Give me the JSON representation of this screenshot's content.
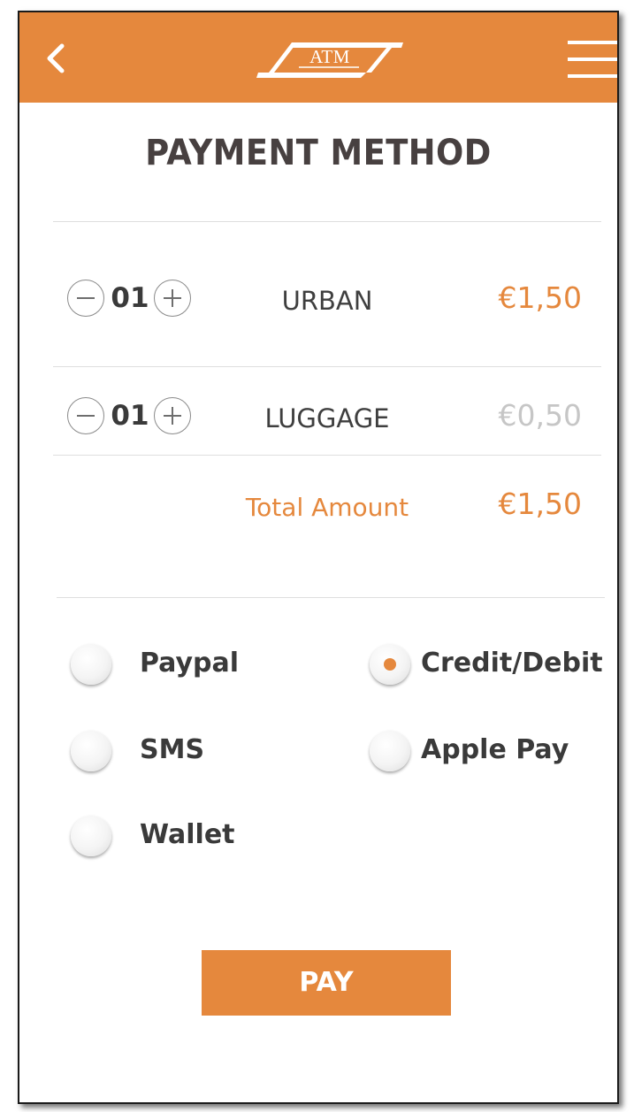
{
  "header": {
    "logo_text": "ATM",
    "back_icon": "chevron-left-icon",
    "menu_icon": "hamburger-menu-icon",
    "background_color": "#e5883d"
  },
  "page": {
    "title": "PAYMENT METHOD"
  },
  "items": [
    {
      "quantity": "01",
      "label": "URBAN",
      "price": "€1,50",
      "price_state": "active"
    },
    {
      "quantity": "01",
      "label": "LUGGAGE",
      "price": "€0,50",
      "price_state": "muted"
    }
  ],
  "total": {
    "label": "Total Amount",
    "value": "€1,50"
  },
  "payment_options": [
    {
      "label": "Paypal",
      "selected": false
    },
    {
      "label": "Credit/Debit",
      "selected": true
    },
    {
      "label": "SMS",
      "selected": false
    },
    {
      "label": "Apple Pay",
      "selected": false
    },
    {
      "label": "Wallet",
      "selected": false
    }
  ],
  "pay_button": {
    "label": "PAY"
  },
  "colors": {
    "accent": "#e5883d",
    "text_dark": "#3a3a3a",
    "muted": "#c6c6c6"
  }
}
